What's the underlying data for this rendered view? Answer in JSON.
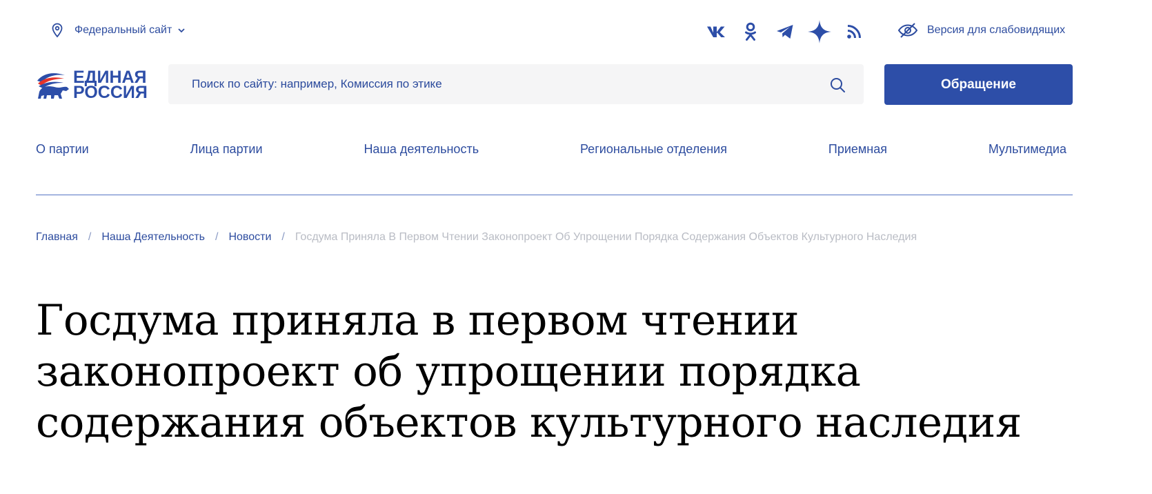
{
  "topbar": {
    "region_label": "Федеральный сайт",
    "socials": [
      {
        "name": "vk",
        "icon": "vk-icon"
      },
      {
        "name": "ok",
        "icon": "odnoklassniki-icon"
      },
      {
        "name": "telegram",
        "icon": "telegram-icon"
      },
      {
        "name": "star",
        "icon": "star-icon"
      },
      {
        "name": "rss",
        "icon": "rss-icon"
      }
    ],
    "accessibility_label": "Версия для слабовидящих"
  },
  "header": {
    "logo_line1": "ЕДИНАЯ",
    "logo_line2": "РОССИЯ",
    "search_placeholder": "Поиск по сайту: например, Комиссия по этике",
    "appeal_button": "Обращение"
  },
  "nav": {
    "items": [
      {
        "label": "О партии"
      },
      {
        "label": "Лица партии"
      },
      {
        "label": "Наша деятельность"
      },
      {
        "label": "Региональные отделения"
      },
      {
        "label": "Приемная"
      },
      {
        "label": "Мультимедиа"
      }
    ]
  },
  "breadcrumbs": {
    "items": [
      {
        "label": "Главная"
      },
      {
        "label": "Наша Деятельность"
      },
      {
        "label": "Новости"
      }
    ],
    "separator": "/",
    "current": "Госдума Приняла В Первом Чтении Законопроект Об Упрощении Порядка Содержания Объектов Культурного Наследия"
  },
  "article": {
    "title_lines": [
      "Госдума приняла в первом чтении",
      "законопроект об упрощении порядка",
      "содержания объектов культурного наследия"
    ]
  },
  "colors": {
    "brand_blue": "#2d4ea8",
    "link_blue": "#2d4c9f",
    "breadcrumb_current": "#b9bcc4",
    "search_bg": "#f5f5f6"
  }
}
